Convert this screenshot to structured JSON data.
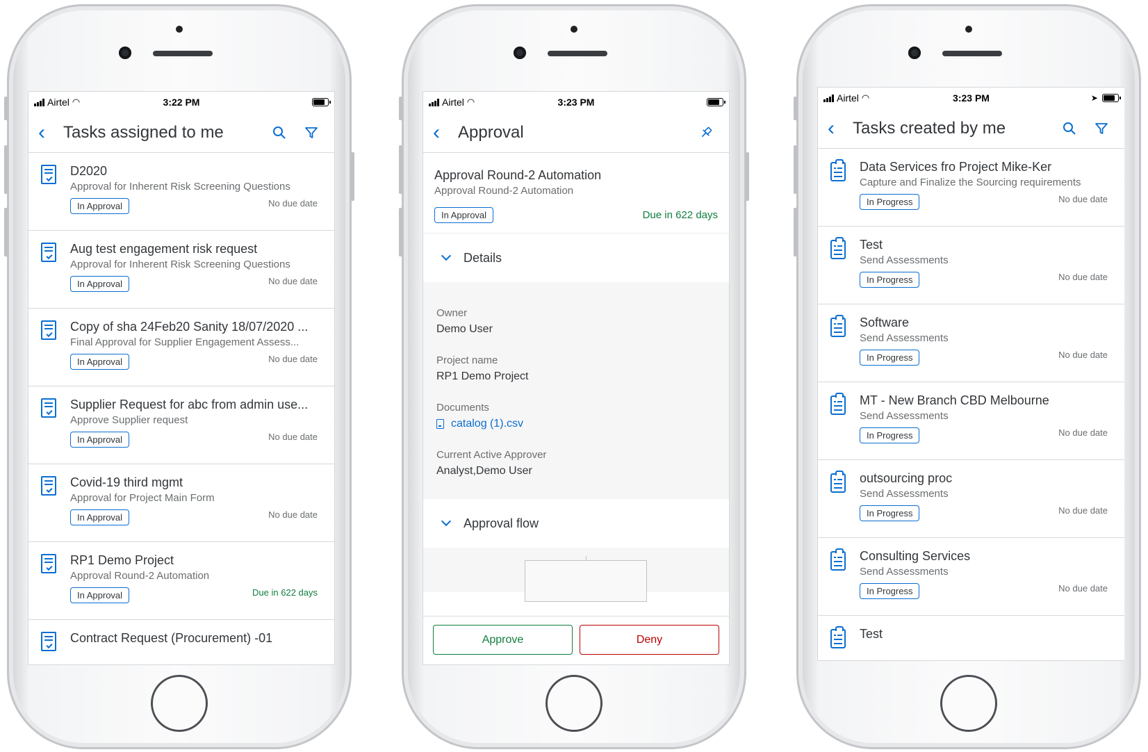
{
  "status_bars": [
    {
      "carrier": "Airtel",
      "time": "3:22 PM"
    },
    {
      "carrier": "Airtel",
      "time": "3:23 PM"
    },
    {
      "carrier": "Airtel",
      "time": "3:23 PM"
    }
  ],
  "screen1": {
    "title": "Tasks assigned to me",
    "tasks": [
      {
        "title": "D2020",
        "subtitle": "Approval for Inherent Risk Screening Questions",
        "status": "In Approval",
        "due": "No due date"
      },
      {
        "title": "Aug test engagement risk request",
        "subtitle": "Approval for Inherent Risk Screening Questions",
        "status": "In Approval",
        "due": "No due date"
      },
      {
        "title": "Copy of sha 24Feb20 Sanity 18/07/2020 ...",
        "subtitle": "Final Approval for Supplier Engagement Assess...",
        "status": "In Approval",
        "due": "No due date"
      },
      {
        "title": "Supplier Request for abc from admin use...",
        "subtitle": "Approve Supplier request",
        "status": "In Approval",
        "due": "No due date"
      },
      {
        "title": "Covid-19 third mgmt",
        "subtitle": "Approval for Project Main Form",
        "status": "In Approval",
        "due": "No due date"
      },
      {
        "title": "RP1 Demo Project",
        "subtitle": "Approval Round-2 Automation",
        "status": "In Approval",
        "due": "Due in 622 days"
      },
      {
        "title": "Contract Request (Procurement) -01"
      }
    ]
  },
  "screen2": {
    "title": "Approval",
    "header": {
      "title": "Approval Round-2 Automation",
      "subtitle": "Approval Round-2 Automation",
      "status": "In Approval",
      "due": "Due in 622 days"
    },
    "details_section": "Details",
    "fields": {
      "owner_label": "Owner",
      "owner_value": "Demo User",
      "project_label": "Project name",
      "project_value": "RP1 Demo Project",
      "documents_label": "Documents",
      "documents_value": "catalog (1).csv",
      "approver_label": "Current Active Approver",
      "approver_value": "Analyst,Demo User"
    },
    "flow_section": "Approval flow",
    "approve_label": "Approve",
    "deny_label": "Deny"
  },
  "screen3": {
    "title": "Tasks created by me",
    "tasks": [
      {
        "title": "Data Services fro Project Mike-Ker",
        "subtitle": "Capture and Finalize the Sourcing requirements",
        "status": "In Progress",
        "due": "No due date"
      },
      {
        "title": "Test",
        "subtitle": "Send Assessments",
        "status": "In Progress",
        "due": "No due date"
      },
      {
        "title": "Software",
        "subtitle": "Send Assessments",
        "status": "In Progress",
        "due": "No due date"
      },
      {
        "title": "MT - New Branch CBD Melbourne",
        "subtitle": "Send Assessments",
        "status": "In Progress",
        "due": "No due date"
      },
      {
        "title": "outsourcing proc",
        "subtitle": "Send Assessments",
        "status": "In Progress",
        "due": "No due date"
      },
      {
        "title": "Consulting Services",
        "subtitle": "Send Assessments",
        "status": "In Progress",
        "due": "No due date"
      },
      {
        "title": "Test"
      }
    ]
  },
  "colors": {
    "accent": "#0a6ed1",
    "positive": "#107e3e",
    "negative": "#bb0000",
    "text": "#32363a",
    "secondary_text": "#6a6d70"
  },
  "icons": [
    "back-icon",
    "search-icon",
    "filter-icon",
    "pin-icon",
    "task-doc-icon",
    "clipboard-icon",
    "chevron-down-icon",
    "file-icon",
    "signal-icon",
    "wifi-icon",
    "battery-icon",
    "location-icon"
  ]
}
